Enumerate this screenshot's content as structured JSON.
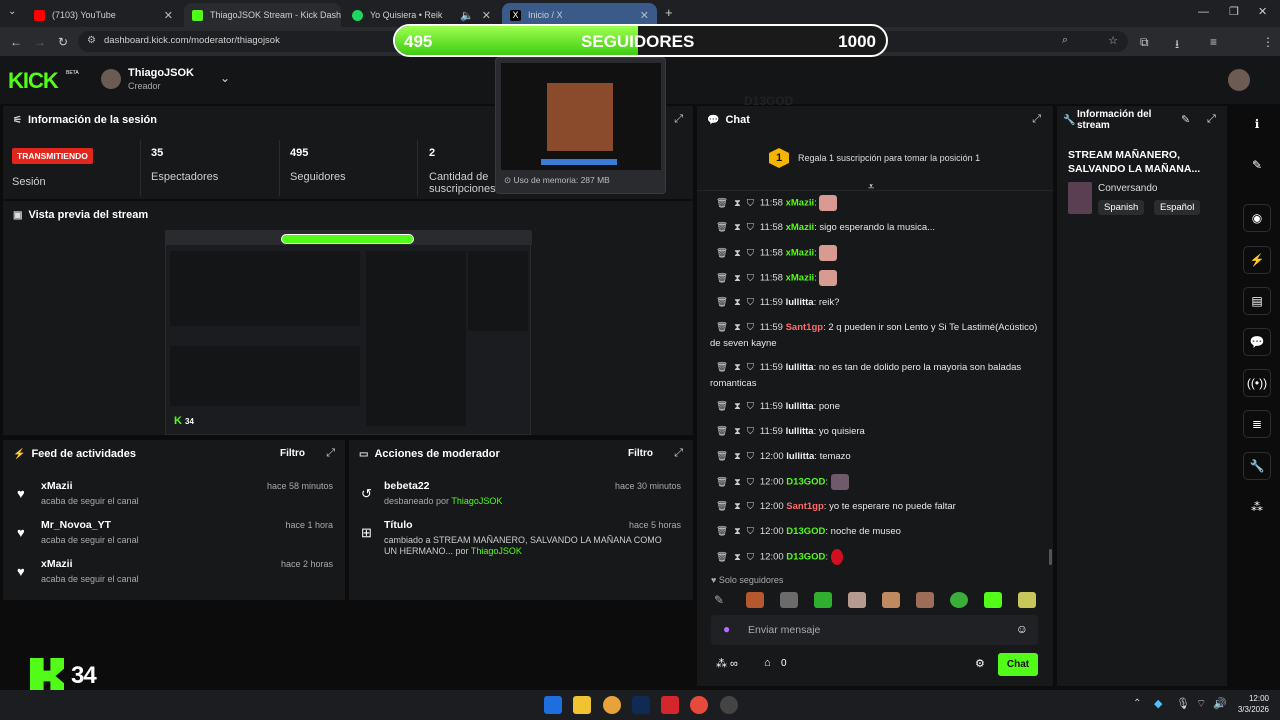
{
  "browser": {
    "tabs": [
      {
        "label": "(7103) YouTube",
        "color": "#ff0000"
      },
      {
        "label": "ThiagoJSOK Stream - Kick Dash",
        "color": "#53fc18"
      },
      {
        "label": "Yo Quisiera • Reik",
        "color": "#1ed760"
      },
      {
        "label": "Inicio / X",
        "color": "#000000"
      }
    ],
    "url": "dashboard.kick.com/moderator/thiagojsok",
    "memory_tooltip": "Uso de memoria: 287 MB"
  },
  "followers_bar": {
    "current": "495",
    "label": "SEGUIDORES",
    "goal": "1000",
    "progress": 0.495
  },
  "app": {
    "logo": "KICK",
    "logo_badge": "BETA",
    "username": "ThiagoJSOK",
    "role": "Creador",
    "watermark": "D13GOD"
  },
  "session": {
    "title": "Información de la sesión",
    "status_badge": "TRANSMITIENDO",
    "status_label": "Sesión",
    "viewers_value": "35",
    "viewers_label": "Espectadores",
    "followers_value": "495",
    "followers_label": "Seguidores",
    "subs_value": "2",
    "subs_label": "Cantidad de suscripciones"
  },
  "preview": {
    "title": "Vista previa del stream",
    "overlay_count": "34"
  },
  "activity": {
    "title": "Feed de actividades",
    "filter": "Filtro",
    "items": [
      {
        "name": "xMazii",
        "desc": "acaba de seguir el canal",
        "time": "hace 58 minutos"
      },
      {
        "name": "Mr_Novoa_YT",
        "desc": "acaba de seguir el canal",
        "time": "hace 1 hora"
      },
      {
        "name": "xMazii",
        "desc": "acaba de seguir el canal",
        "time": "hace 2 horas"
      }
    ]
  },
  "modactions": {
    "title": "Acciones de moderador",
    "filter": "Filtro",
    "items": [
      {
        "name": "bebeta22",
        "desc": "desbaneado por",
        "by": "ThiagoJSOK",
        "time": "hace 30 minutos"
      },
      {
        "name": "Título",
        "desc": "cambiado a STREAM MAÑANERO, SALVANDO LA MAÑANA COMO UN HERMANO... por",
        "by": "ThiagoJSOK",
        "time": "hace 5 horas"
      }
    ]
  },
  "chat": {
    "title": "Chat",
    "gift_text": "Regala 1 suscripción para tomar la posición 1",
    "gift_rank": "1",
    "messages": [
      {
        "time": "11:58",
        "user": "xMazii",
        "ucolor": "green",
        "text": "",
        "emote": true
      },
      {
        "time": "11:58",
        "user": "xMazii",
        "ucolor": "green",
        "text": "sigo esperando la musica...",
        "emote": false
      },
      {
        "time": "11:58",
        "user": "xMazii",
        "ucolor": "green",
        "text": "",
        "emote": true
      },
      {
        "time": "11:58",
        "user": "xMazii",
        "ucolor": "green",
        "text": "",
        "emote": true
      },
      {
        "time": "11:59",
        "user": "lullitta",
        "ucolor": "white",
        "text": "reik?",
        "emote": false
      },
      {
        "time": "11:59",
        "user": "Sant1gp",
        "ucolor": "red",
        "text": "2 q pueden ir son Lento y Si Te Lastimé(Acústico) de seven kayne",
        "emote": false
      },
      {
        "time": "11:59",
        "user": "lullitta",
        "ucolor": "white",
        "text": "no es tan de dolido pero la mayoria son baladas romanticas",
        "emote": false
      },
      {
        "time": "11:59",
        "user": "lullitta",
        "ucolor": "white",
        "text": "pone",
        "emote": false
      },
      {
        "time": "11:59",
        "user": "lullitta",
        "ucolor": "white",
        "text": "yo quisiera",
        "emote": false
      },
      {
        "time": "12:00",
        "user": "lullitta",
        "ucolor": "white",
        "text": "temazo",
        "emote": false
      },
      {
        "time": "12:00",
        "user": "D13GOD",
        "ucolor": "green",
        "text": "",
        "emote": true
      },
      {
        "time": "12:00",
        "user": "Sant1gp",
        "ucolor": "red",
        "text": "yo te esperare no puede faltar",
        "emote": false
      },
      {
        "time": "12:00",
        "user": "D13GOD",
        "ucolor": "green",
        "text": "noche de museo",
        "emote": false
      },
      {
        "time": "12:00",
        "user": "D13GOD",
        "ucolor": "green",
        "text": "",
        "emote": true
      }
    ],
    "followers_only": "Solo seguidores",
    "input_placeholder": "Enviar mensaje",
    "send_button": "Chat",
    "points": "0"
  },
  "stream_info": {
    "title": "Información del stream",
    "stream_title": "STREAM MAÑANERO, SALVANDO LA MAÑANA...",
    "category": "Conversando",
    "tags": [
      "Spanish",
      "Español"
    ]
  },
  "overlay_kick": {
    "count": "34"
  },
  "taskbar": {
    "time": "12:00",
    "date": "3/3/2026"
  },
  "colors": {
    "kick_green": "#53fc18",
    "live_red": "#e0261d",
    "panel": "#17181a"
  }
}
